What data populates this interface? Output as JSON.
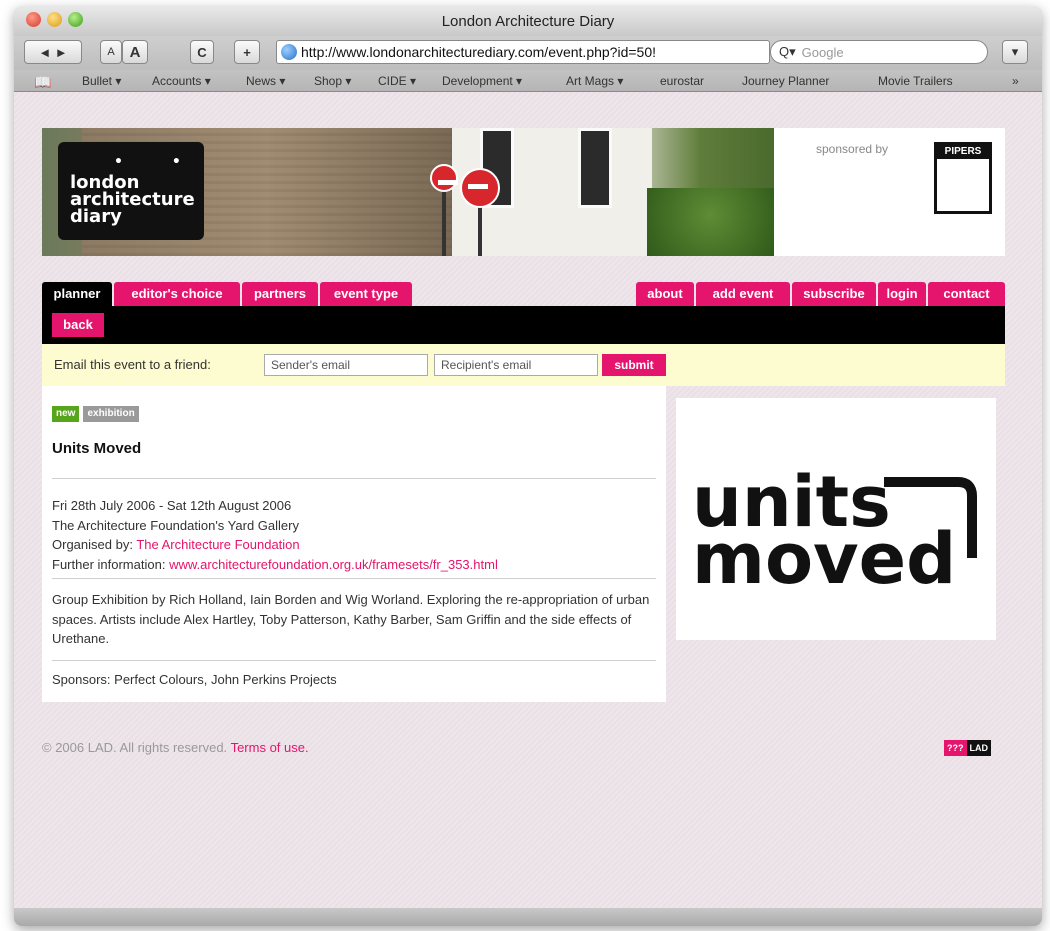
{
  "window": {
    "title": "London Architecture Diary"
  },
  "toolbar": {
    "back_forward": "◄ ►",
    "text_smaller": "A",
    "text_bigger": "A",
    "reload": "C",
    "add_bookmark": "+",
    "url": "http://www.londonarchitecturediary.com/event.php?id=50!",
    "search_prefix": "Q▾",
    "search_placeholder": "Google",
    "actions": "▾"
  },
  "bookmarks": [
    {
      "label": "Bullet ▾"
    },
    {
      "label": "Accounts ▾"
    },
    {
      "label": "News ▾"
    },
    {
      "label": "Shop ▾"
    },
    {
      "label": "CIDE ▾"
    },
    {
      "label": "Development ▾"
    },
    {
      "label": "Art Mags ▾"
    },
    {
      "label": "eurostar"
    },
    {
      "label": "Journey Planner"
    },
    {
      "label": "Movie Trailers"
    },
    {
      "label": "»"
    }
  ],
  "banner": {
    "logo_line1": "london",
    "logo_line2": "architecture",
    "logo_line3": "diary",
    "logo_dots": "• •",
    "sponsored_by": "sponsored by",
    "sponsor_name": "PIPERS"
  },
  "nav": {
    "left_tabs": [
      "planner",
      "editor's choice",
      "partners",
      "event type"
    ],
    "right_tabs": [
      "about",
      "add event",
      "subscribe",
      "login",
      "contact"
    ],
    "back": "back"
  },
  "email_form": {
    "label": "Email this event to a friend:",
    "sender_placeholder": "Sender's email",
    "recipient_placeholder": "Recipient's email",
    "submit": "submit"
  },
  "event": {
    "badge_new": "new",
    "badge_type": "exhibition",
    "title": "Units Moved",
    "dates": "Fri 28th July 2006 - Sat 12th August 2006",
    "venue": "The Architecture Foundation's Yard Gallery",
    "organised_label": "Organised by:",
    "organiser": "The Architecture Foundation",
    "further_label": "Further information:",
    "further_link": "www.architecturefoundation.org.uk/framesets/fr_353.html",
    "description": "Group Exhibition by Rich Holland, Iain Borden and Wig Worland. Exploring the re-appropriation of urban spaces. Artists include Alex Hartley, Toby Patterson, Kathy Barber, Sam Griffin and the side effects of Urethane.",
    "sponsors": "Sponsors: Perfect Colours, John Perkins Projects"
  },
  "side_image": {
    "line1": "units",
    "line2": "moved"
  },
  "footer": {
    "copyright": "© 2006 LAD. All rights reserved.",
    "terms": "Terms of use.",
    "mini_logo_left": "???",
    "mini_logo_right": "LAD"
  }
}
